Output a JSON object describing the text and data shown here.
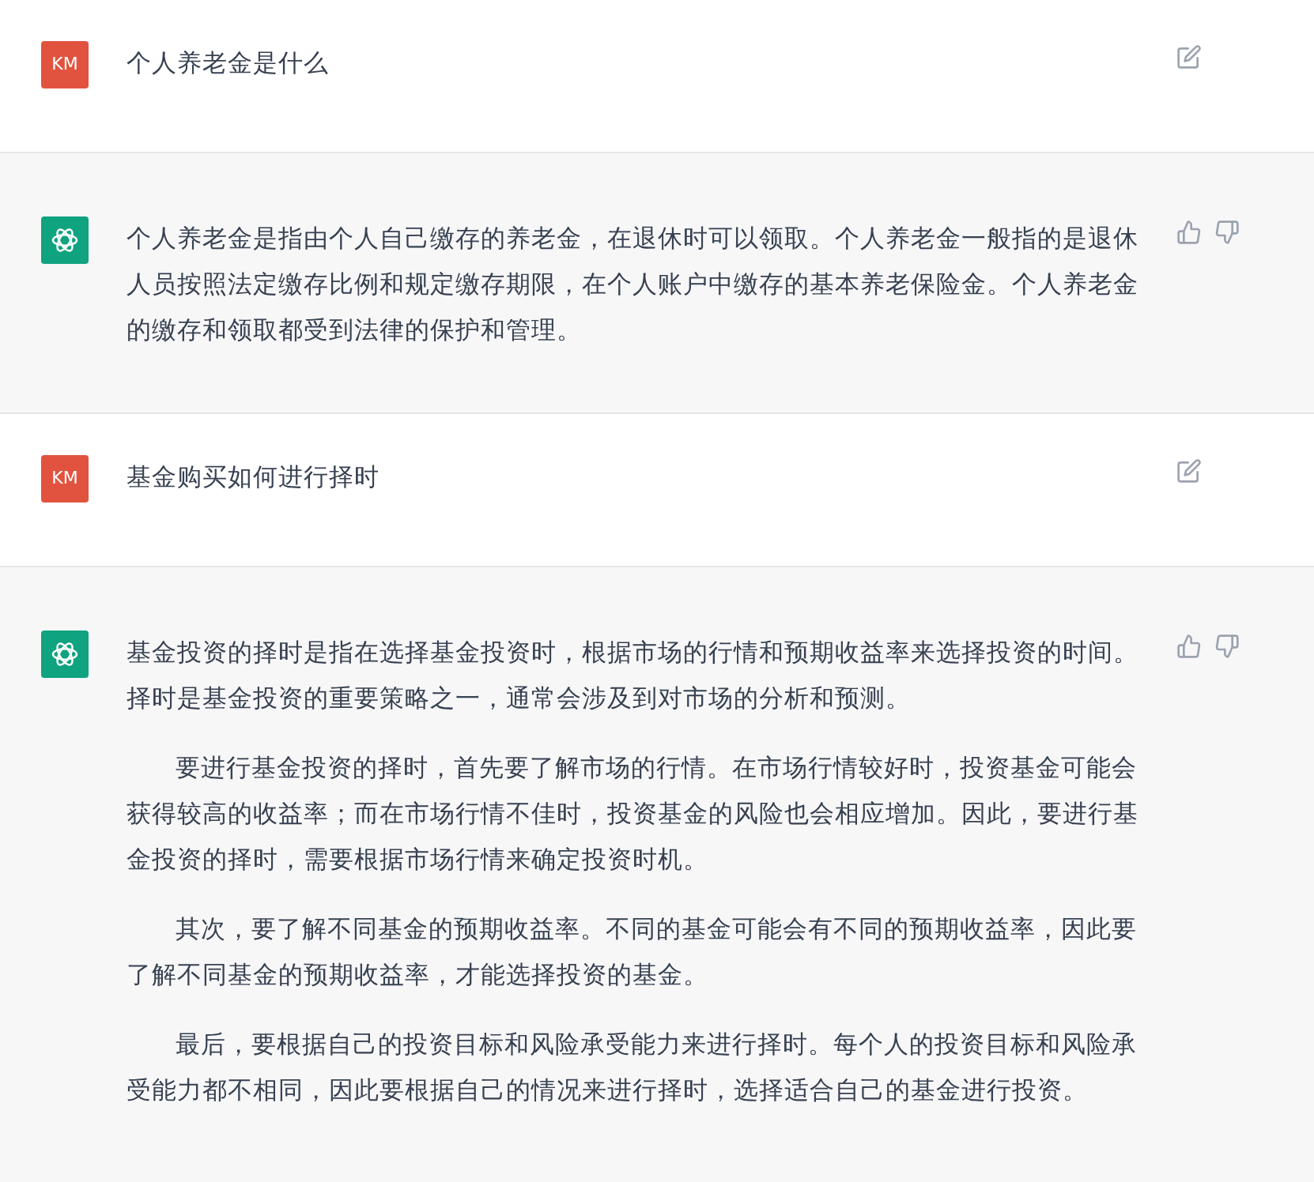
{
  "messages": [
    {
      "kind": "user",
      "avatar": "KM",
      "paragraphs": [
        "个人养老金是什么"
      ]
    },
    {
      "kind": "assistant",
      "paragraphs": [
        "个人养老金是指由个人自己缴存的养老金，在退休时可以领取。个人养老金一般指的是退休人员按照法定缴存比例和规定缴存期限，在个人账户中缴存的基本养老保险金。个人养老金的缴存和领取都受到法律的保护和管理。"
      ]
    },
    {
      "kind": "user",
      "avatar": "KM",
      "paragraphs": [
        "基金购买如何进行择时"
      ]
    },
    {
      "kind": "assistant",
      "paragraphs": [
        "基金投资的择时是指在选择基金投资时，根据市场的行情和预期收益率来选择投资的时间。择时是基金投资的重要策略之一，通常会涉及到对市场的分析和预测。",
        "要进行基金投资的择时，首先要了解市场的行情。在市场行情较好时，投资基金可能会获得较高的收益率；而在市场行情不佳时，投资基金的风险也会相应增加。因此，要进行基金投资的择时，需要根据市场行情来确定投资时机。",
        "其次，要了解不同基金的预期收益率。不同的基金可能会有不同的预期收益率，因此要了解不同基金的预期收益率，才能选择投资的基金。",
        "最后，要根据自己的投资目标和风险承受能力来进行择时。每个人的投资目标和风险承受能力都不相同，因此要根据自己的情况来进行择时，选择适合自己的基金进行投资。"
      ]
    }
  ]
}
